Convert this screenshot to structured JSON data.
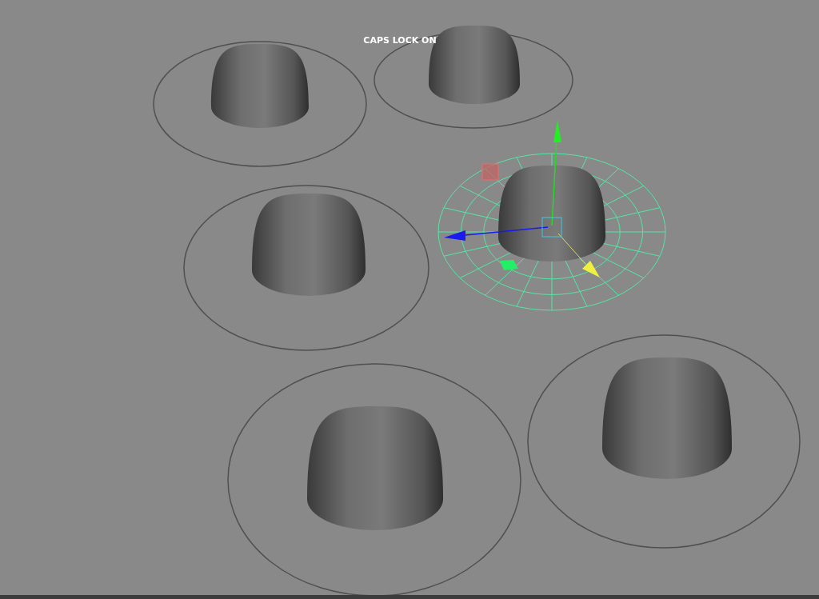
{
  "viewport": {
    "message": "CAPS LOCK ON"
  },
  "objects": [
    {
      "selected": false
    },
    {
      "selected": false
    },
    {
      "selected": false
    },
    {
      "selected": true
    },
    {
      "selected": false
    },
    {
      "selected": false
    }
  ]
}
